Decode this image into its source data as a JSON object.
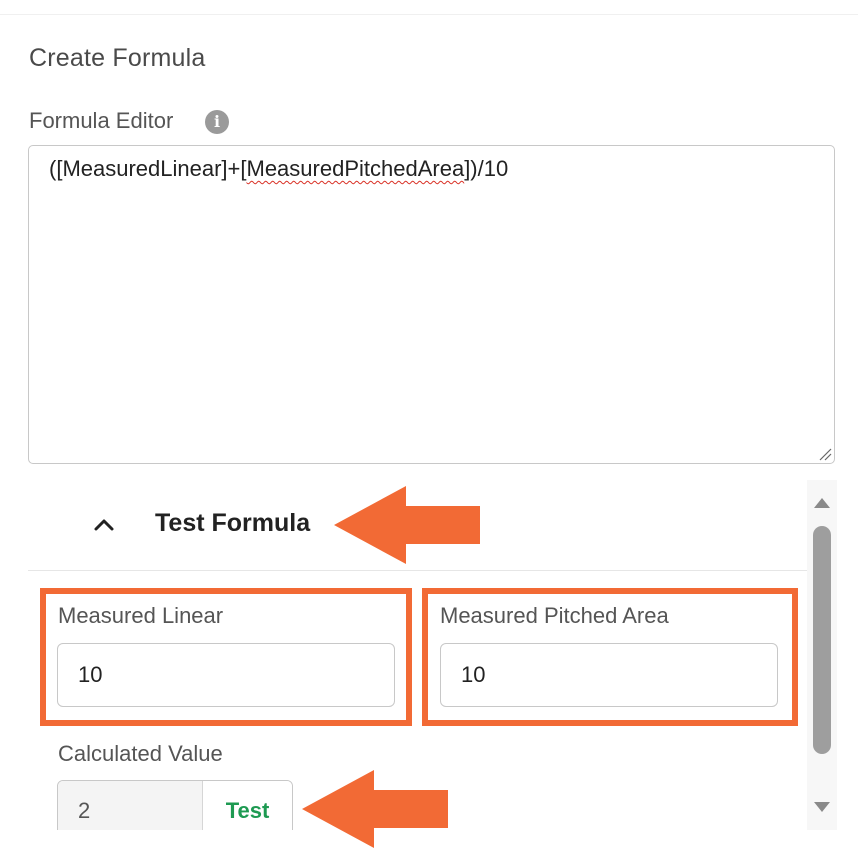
{
  "panel": {
    "title": "Create Formula",
    "editor_label": "Formula Editor",
    "info_icon": "i",
    "formula_prefix": "([MeasuredLinear]+[",
    "formula_flagged": "MeasuredPitchedArea",
    "formula_suffix": "])/10"
  },
  "test_section": {
    "title": "Test Formula",
    "collapse_icon": "chevron-up-icon",
    "fields": [
      {
        "label": "Measured Linear",
        "value": "10"
      },
      {
        "label": "Measured Pitched Area",
        "value": "10"
      }
    ],
    "calculated_label": "Calculated Value",
    "calculated_value": "2",
    "test_button_label": "Test"
  },
  "colors": {
    "highlight": "#f26a35",
    "test_button_text": "#1e9a52",
    "spellcheck": "#d93025"
  }
}
